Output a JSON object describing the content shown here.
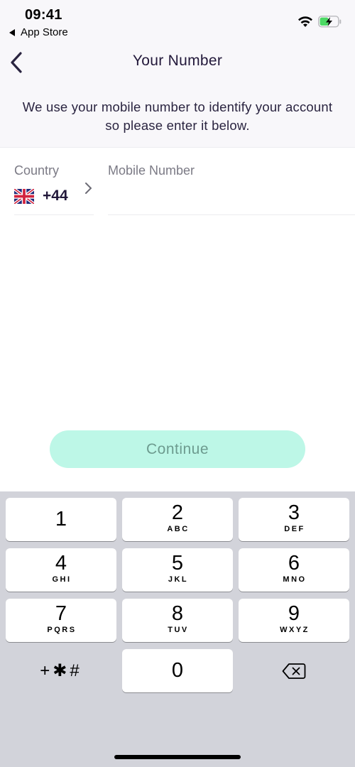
{
  "status_bar": {
    "time": "09:41",
    "back_app": "App Store",
    "icons": [
      "wifi-icon",
      "battery-charging-icon"
    ],
    "battery_color": "#4cd964"
  },
  "nav": {
    "title": "Your Number",
    "back_icon": "chevron-left-icon"
  },
  "intro_text": "We use your mobile number to identify your account so please enter it below.",
  "form": {
    "country_label": "Country",
    "country_flag": "uk-flag-icon",
    "dial_code": "+44",
    "mobile_label": "Mobile Number",
    "mobile_value": "",
    "mobile_placeholder": ""
  },
  "continue_button": {
    "label": "Continue",
    "enabled": false,
    "bg_color": "#bdf7e7",
    "text_color": "#6d9b8f"
  },
  "keypad": {
    "keys": [
      {
        "digit": "1",
        "letters": ""
      },
      {
        "digit": "2",
        "letters": "ABC"
      },
      {
        "digit": "3",
        "letters": "DEF"
      },
      {
        "digit": "4",
        "letters": "GHI"
      },
      {
        "digit": "5",
        "letters": "JKL"
      },
      {
        "digit": "6",
        "letters": "MNO"
      },
      {
        "digit": "7",
        "letters": "PQRS"
      },
      {
        "digit": "8",
        "letters": "TUV"
      },
      {
        "digit": "9",
        "letters": "WXYZ"
      },
      {
        "digit": "0",
        "letters": ""
      }
    ],
    "symbols_label": "+✱#",
    "delete_icon": "backspace-icon"
  }
}
